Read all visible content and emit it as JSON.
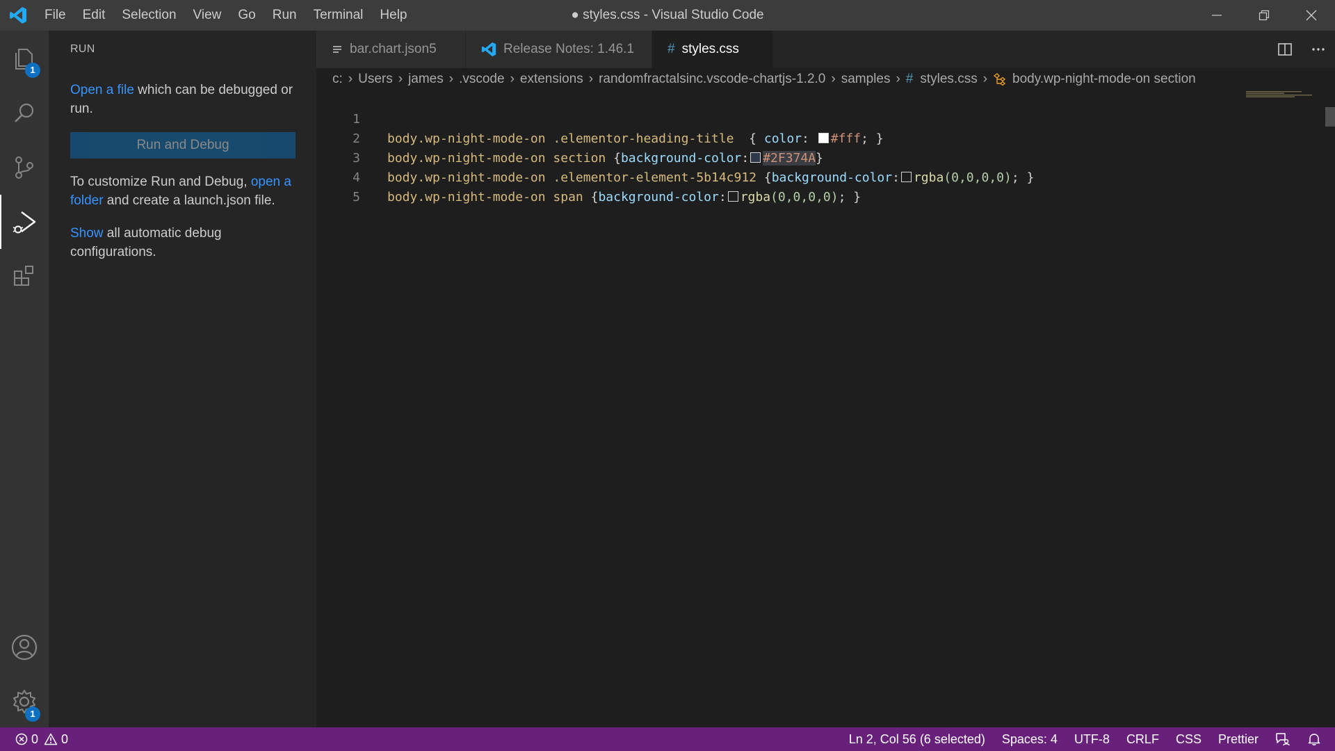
{
  "window": {
    "title": "● styles.css - Visual Studio Code"
  },
  "menu": [
    "File",
    "Edit",
    "Selection",
    "View",
    "Go",
    "Run",
    "Terminal",
    "Help"
  ],
  "activity_bar": {
    "explorer_badge": "1",
    "settings_badge": "1",
    "active": "run-and-debug"
  },
  "sidebar": {
    "title": "RUN",
    "open_file_link": "Open a file",
    "open_file_rest": " which can be debugged or run.",
    "run_button": "Run and Debug",
    "customize_text": "To customize Run and Debug, ",
    "open_folder_link": "open a folder",
    "customize_rest": " and create a launch.json file.",
    "show_link": "Show",
    "show_rest": " all automatic debug configurations."
  },
  "tabs": [
    {
      "label": "bar.chart.json5",
      "icon": "lines-icon",
      "active": false
    },
    {
      "label": "Release Notes: 1.46.1",
      "icon": "vscode-logo-icon",
      "active": false
    },
    {
      "label": "styles.css",
      "icon": "hash-icon",
      "active": true,
      "dirty": true
    }
  ],
  "breadcrumb": [
    "c:",
    "Users",
    "james",
    ".vscode",
    "extensions",
    "randomfractalsinc.vscode-chartjs-1.2.0",
    "samples",
    "styles.css",
    "body.wp-night-mode-on section"
  ],
  "editor": {
    "line_numbers": [
      "1",
      "2",
      "3",
      "4",
      "5"
    ],
    "lines": [
      {
        "selector": "body.wp-night-mode-on .elementor-heading-title  ",
        "open": "{ ",
        "prop": "color",
        "colon": ": ",
        "swatch": "#ffffff",
        "value": "#fff",
        "close": "; }"
      },
      {
        "selector": "body.wp-night-mode-on section ",
        "open": "{",
        "prop": "background-color",
        "colon": ":",
        "swatch": "#2F374A",
        "value": "#2F374A",
        "close": "}"
      },
      {
        "selector": "body.wp-night-mode-on .elementor-element-5b14c912 ",
        "open": "{",
        "prop": "background-color",
        "colon": ":",
        "swatch": "transparent",
        "value_fn": "rgba",
        "value_args": "(0,0,0,0)",
        "close": "; }"
      },
      {
        "selector": "body.wp-night-mode-on span ",
        "open": "{",
        "prop": "background-color",
        "colon": ":",
        "swatch": "transparent",
        "value_fn": "rgba",
        "value_args": "(0,0,0,0)",
        "close": "; }"
      }
    ]
  },
  "status_bar": {
    "errors": "0",
    "warnings": "0",
    "cursor": "Ln 2, Col 56 (6 selected)",
    "spaces": "Spaces: 4",
    "encoding": "UTF-8",
    "eol": "CRLF",
    "language": "CSS",
    "formatter": "Prettier",
    "color": "#68217a"
  }
}
